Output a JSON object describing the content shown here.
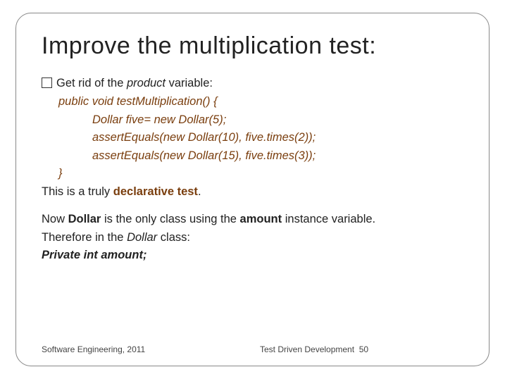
{
  "title": "Improve the multiplication test:",
  "bullet": {
    "pre": "Get rid of the ",
    "emph": "product",
    "post": " variable:"
  },
  "code": {
    "l1": "public void testMultiplication() {",
    "l2": "Dollar five= new Dollar(5);",
    "l3": "assertEquals(new Dollar(10), five.times(2));",
    "l4": "assertEquals(new Dollar(15), five.times(3));",
    "l5": "}"
  },
  "decl_line": {
    "pre": "This is a truly ",
    "emph": "declarative test",
    "post": "."
  },
  "para2": {
    "pre1": "Now ",
    "b1": "Dollar",
    "mid1": " is the only class using the ",
    "b2": "amount",
    "post1": " instance variable."
  },
  "para3": {
    "pre": "Therefore in the ",
    "emph": "Dollar",
    "post": " class:"
  },
  "priv": "Private int amount;",
  "footer": {
    "left": "Software Engineering,   2011",
    "right_text": "Test Driven Development",
    "page": "50"
  }
}
